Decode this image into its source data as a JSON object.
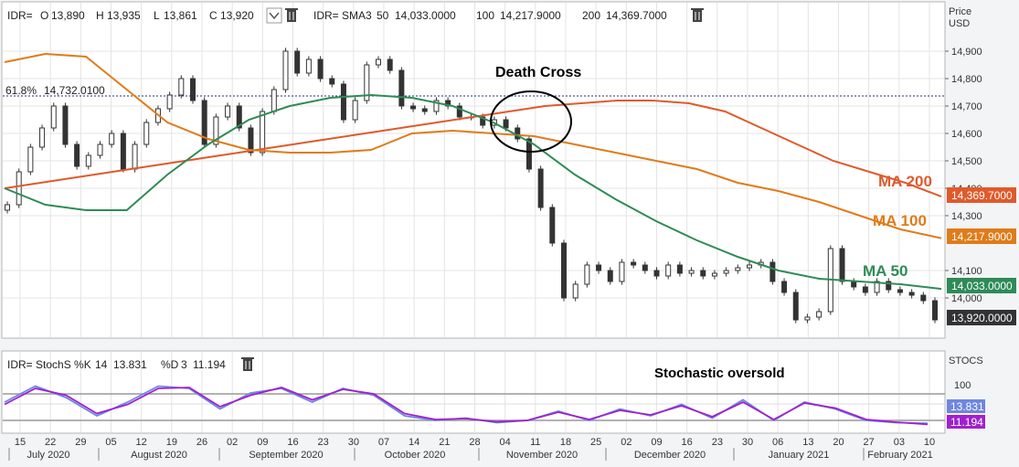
{
  "colors": {
    "ma50": "#2e8b57",
    "ma100": "#e07b1a",
    "ma200": "#e05a2b",
    "stoch_k": "#6e86e0",
    "stoch_d": "#a020d0",
    "badge_price": "#333333",
    "fib": "#1f2d8c"
  },
  "header": {
    "ohlc": {
      "symbol": "IDR=",
      "o_label": "O",
      "o": "13,890",
      "h_label": "H",
      "h": "13,935",
      "l_label": "L",
      "l": "13,861",
      "c_label": "C",
      "c": "13,920"
    },
    "dropdown_icon": "chevron-down-icon",
    "trash_icon": "trash-icon",
    "sma": {
      "label": "IDR= SMA3",
      "p50": "50",
      "v50": "14,033.0000",
      "p100": "100",
      "v100": "14,217.9000",
      "p200": "200",
      "v200": "14,369.7000"
    }
  },
  "stoch_header": {
    "label": "IDR= StochS %K",
    "k_period": "14",
    "k_value": "13.831",
    "d_label": "%D",
    "d_period": "3",
    "d_value": "11.194"
  },
  "annotations": {
    "death_cross": "Death Cross",
    "stoch_oversold": "Stochastic oversold",
    "ma200": "MA 200",
    "ma100": "MA 100",
    "ma50": "MA 50",
    "fib": "61.8%",
    "fib_value": "14,732.0100"
  },
  "price_axis": {
    "title1": "Price",
    "title2": "USD",
    "ticks": [
      "14,900",
      "14,800",
      "14,700",
      "14,600",
      "14,500",
      "14,400",
      "14,300",
      "14,100",
      "14,000"
    ],
    "tick_values": [
      14900,
      14800,
      14700,
      14600,
      14500,
      14400,
      14300,
      14100,
      14000
    ],
    "badges": {
      "ma200": "14,369.7000",
      "ma100": "14,217.9000",
      "ma50": "14,033.0000",
      "close": "13,920.0000"
    }
  },
  "stoch_axis": {
    "title": "STOCS",
    "tick": "100",
    "badge_k": "13.831",
    "badge_d": "11.194"
  },
  "x_axis": {
    "days": [
      "15",
      "22",
      "29",
      "05",
      "12",
      "19",
      "26",
      "02",
      "09",
      "16",
      "23",
      "30",
      "07",
      "14",
      "21",
      "28",
      "04",
      "11",
      "18",
      "25",
      "02",
      "09",
      "16",
      "23",
      "30",
      "06",
      "13",
      "20",
      "27",
      "03",
      "10"
    ],
    "months": [
      "July 2020",
      "August 2020",
      "September 2020",
      "October 2020",
      "November 2020",
      "December 2020",
      "January 2021",
      "February 2021"
    ]
  },
  "chart_data": {
    "type": "line",
    "title": "",
    "ylabel": "Price USD",
    "ylim": [
      13860,
      14960
    ],
    "stoch_ylim": [
      0,
      120
    ],
    "x_dates": [
      "2020-07-15",
      "2021-02-15"
    ],
    "fib_level": 14732.01,
    "candles_close": [
      14340,
      14460,
      14550,
      14620,
      14700,
      14560,
      14480,
      14520,
      14560,
      14600,
      14470,
      14560,
      14640,
      14690,
      14740,
      14800,
      14720,
      14560,
      14660,
      14700,
      14620,
      14530,
      14680,
      14760,
      14900,
      14820,
      14870,
      14800,
      14780,
      14650,
      14720,
      14850,
      14870,
      14830,
      14700,
      14690,
      14680,
      14720,
      14700,
      14660,
      14660,
      14630,
      14650,
      14620,
      14580,
      14470,
      14330,
      14200,
      14000,
      14050,
      14120,
      14100,
      14060,
      14130,
      14120,
      14100,
      14080,
      14120,
      14090,
      14100,
      14080,
      14090,
      14100,
      14110,
      14120,
      14130,
      14060,
      14020,
      13920,
      13930,
      13950,
      14180,
      14060,
      14040,
      14020,
      14060,
      14030,
      14020,
      14010,
      13990,
      13920
    ],
    "series": [
      {
        "name": "MA 200",
        "values": [
          14400,
          14420,
          14440,
          14460,
          14480,
          14500,
          14520,
          14540,
          14560,
          14580,
          14600,
          14620,
          14640,
          14660,
          14680,
          14700,
          14710,
          14720,
          14720,
          14710,
          14680,
          14620,
          14560,
          14500,
          14460,
          14420,
          14369.7
        ]
      },
      {
        "name": "MA 100",
        "values": [
          14860,
          14890,
          14880,
          14760,
          14640,
          14580,
          14540,
          14530,
          14530,
          14540,
          14600,
          14610,
          14600,
          14590,
          14560,
          14530,
          14500,
          14470,
          14420,
          14390,
          14350,
          14300,
          14250,
          14217.9
        ]
      },
      {
        "name": "MA 50",
        "values": [
          14400,
          14340,
          14320,
          14320,
          14450,
          14560,
          14650,
          14700,
          14730,
          14740,
          14730,
          14700,
          14640,
          14560,
          14450,
          14360,
          14280,
          14210,
          14150,
          14100,
          14070,
          14060,
          14050,
          14033
        ]
      }
    ],
    "stoch": {
      "k": [
        60,
        95,
        70,
        30,
        60,
        95,
        90,
        45,
        80,
        90,
        60,
        90,
        75,
        30,
        20,
        25,
        15,
        20,
        40,
        20,
        45,
        30,
        55,
        25,
        65,
        20,
        60,
        45,
        20,
        15,
        13.831
      ],
      "d": [
        55,
        90,
        75,
        35,
        55,
        90,
        92,
        50,
        75,
        92,
        65,
        88,
        78,
        35,
        22,
        24,
        17,
        20,
        38,
        22,
        42,
        32,
        52,
        28,
        60,
        22,
        58,
        47,
        22,
        16,
        11.194
      ]
    }
  }
}
